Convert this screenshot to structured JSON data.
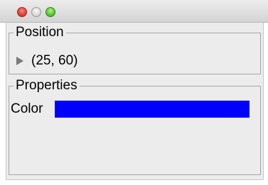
{
  "window": {
    "controls": [
      "close",
      "minimize",
      "zoom"
    ]
  },
  "position_group": {
    "title": "Position",
    "value": "(25, 60)",
    "expander_icon": "disclosure-triangle-right"
  },
  "properties_group": {
    "title": "Properties",
    "rows": [
      {
        "label": "Color",
        "value_color": "#0000ff"
      }
    ]
  },
  "colors": {
    "swatch": "#0000ff",
    "panel_bg": "#ececec",
    "close": "#e0443b",
    "zoom": "#5fc83a"
  }
}
